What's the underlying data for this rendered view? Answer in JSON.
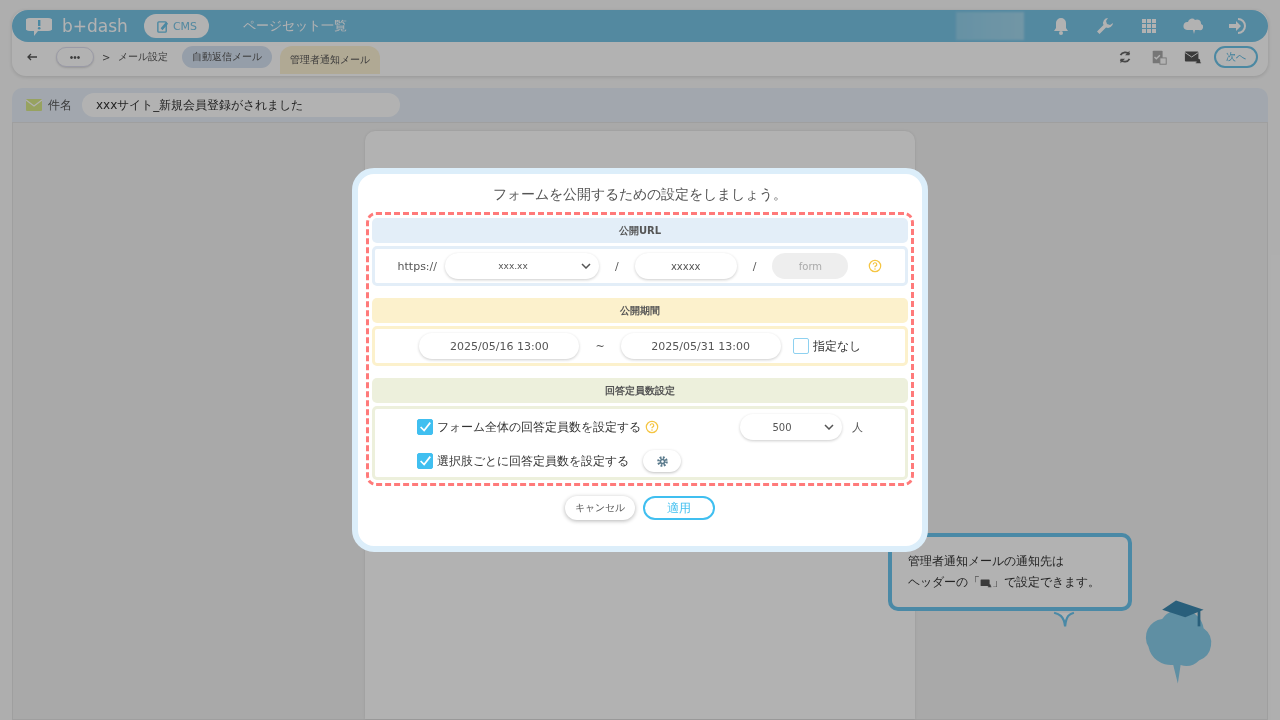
{
  "header": {
    "logo": "b+dash",
    "app_button": "CMS",
    "page_title": "ページセット一覧"
  },
  "breadcrumb": {
    "more": "•••",
    "separator": ">",
    "current": "メール設定"
  },
  "tabs": [
    {
      "label": "自動返信メール",
      "selected": false
    },
    {
      "label": "管理者通知メール",
      "selected": true
    }
  ],
  "next_button": "次へ",
  "subject": {
    "label": "件名",
    "value": "xxxサイト_新規会員登録がされました"
  },
  "dialog": {
    "title": "フォームを公開するための設定をしましょう。",
    "sections": [
      {
        "kind": "url",
        "heading": "公開URL",
        "color": "#e3eef8",
        "prefix": "https://",
        "domain": "xxx.xx",
        "separator": "/",
        "path": "xxxxx",
        "separator_2": "/",
        "placeholder": "form"
      },
      {
        "kind": "period",
        "heading": "公開期間",
        "color": "#fcf1cc",
        "start": "2025/05/16 13:00",
        "tilde": "~",
        "end": "2025/05/31 13:00",
        "none_option": {
          "label": "指定なし",
          "checked": false
        }
      },
      {
        "kind": "capacity",
        "heading": "回答定員数設定",
        "color": "#edf0dc",
        "rows": [
          {
            "kind": "total",
            "label": "フォーム全体の回答定員数を設定する",
            "checked": true,
            "count": "500",
            "unit": "人"
          },
          {
            "kind": "per_choice",
            "label": "選択肢ごとに回答定員数を設定する",
            "checked": true
          }
        ]
      }
    ],
    "cancel_button": "キャンセル",
    "apply_button": "適用"
  },
  "tooltip": {
    "line_1": "管理者通知メールの通知先は",
    "line_2_before": "ヘッダーの「",
    "line_2_after": "」で設定できます。"
  }
}
